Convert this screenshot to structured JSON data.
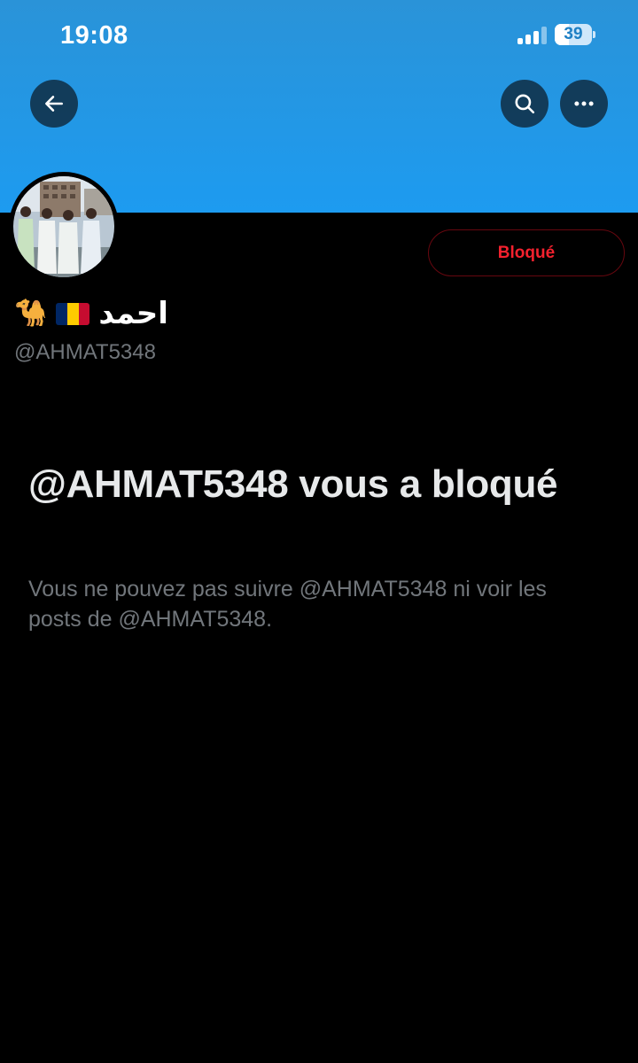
{
  "status_bar": {
    "time": "19:08",
    "battery_level": "39",
    "signal_bars_active": 3,
    "signal_bars_total": 4
  },
  "header": {
    "back_icon": "arrow-left-icon",
    "search_icon": "search-icon",
    "more_icon": "more-horizontal-icon",
    "banner_color": "#1d9bf0"
  },
  "profile": {
    "display_name": "احمد",
    "flag_icon": "chad-flag-icon",
    "emoji": "🐪",
    "handle": "@AHMAT5348",
    "blocked_button_label": "Bloqué",
    "blocked_button_color": "#f4212e"
  },
  "blocked_notice": {
    "title": "@AHMAT5348 vous a bloqué",
    "description": "Vous ne pouvez pas suivre @AHMAT5348 ni voir les posts de @AHMAT5348."
  }
}
